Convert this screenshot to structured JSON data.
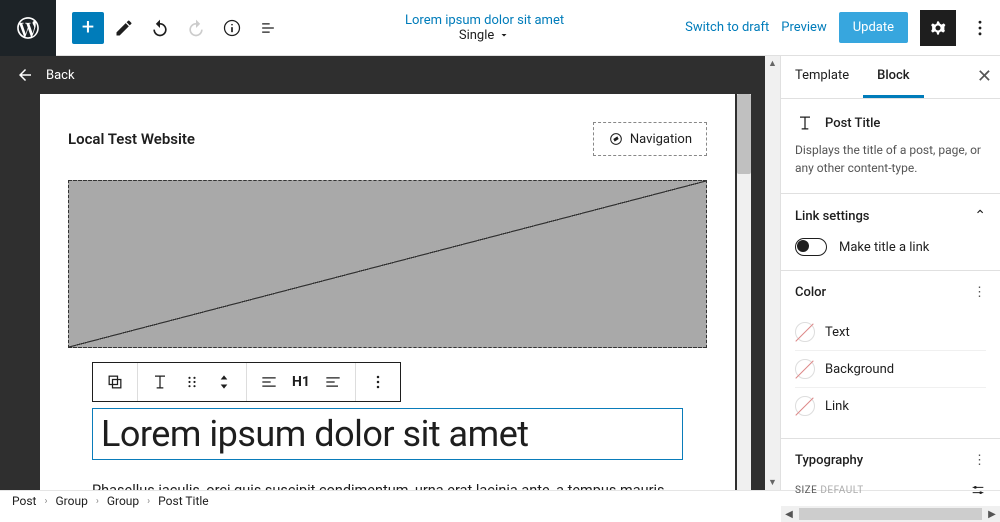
{
  "topbar": {
    "doc_title": "Lorem ipsum dolor sit amet",
    "template": "Single",
    "switch_draft": "Switch to draft",
    "preview": "Preview",
    "update": "Update"
  },
  "back": {
    "label": "Back"
  },
  "canvas": {
    "site_title": "Local Test Website",
    "nav_label": "Navigation",
    "post_title": "Lorem ipsum dolor sit amet",
    "body": "Phasellus iaculis, orci quis suscipit condimentum, urna erat lacinia ante, a tempus mauris"
  },
  "block_toolbar": {
    "heading": "H1"
  },
  "sidebar": {
    "tabs": {
      "template": "Template",
      "block": "Block"
    },
    "block_name": "Post Title",
    "block_desc": "Displays the title of a post, page, or any other content-type.",
    "panels": {
      "link": {
        "title": "Link settings",
        "toggle_label": "Make title a link"
      },
      "color": {
        "title": "Color",
        "items": [
          "Text",
          "Background",
          "Link"
        ]
      },
      "typography": {
        "title": "Typography",
        "size_label": "SIZE",
        "size_default": "DEFAULT"
      }
    }
  },
  "breadcrumbs": [
    "Post",
    "Group",
    "Group",
    "Post Title"
  ]
}
